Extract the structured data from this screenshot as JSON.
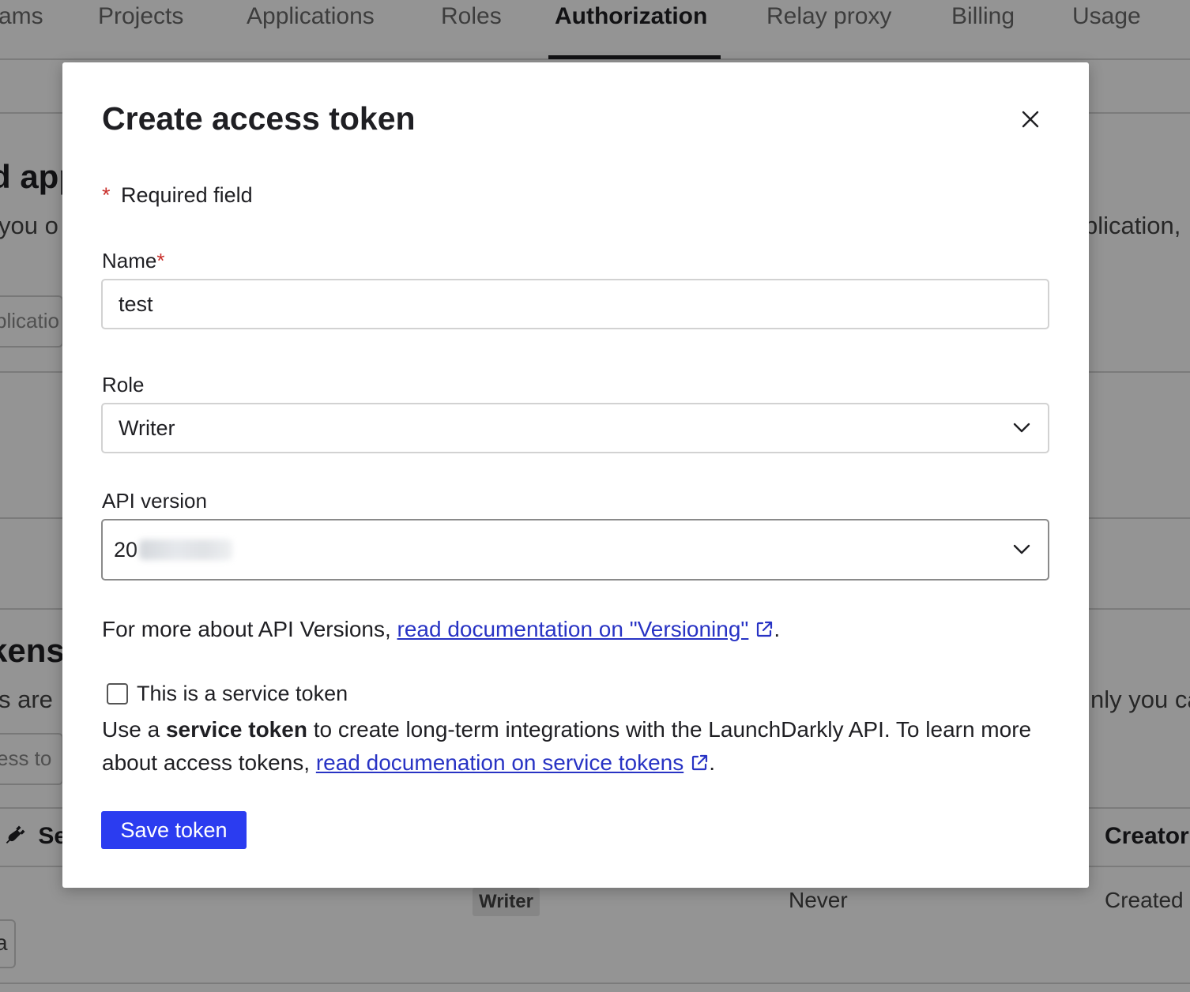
{
  "background": {
    "tabs": [
      "ams",
      "Projects",
      "Applications",
      "Roles",
      "Authorization",
      "Relay proxy",
      "Billing",
      "Usage"
    ],
    "active_tab": "Authorization",
    "heading_fragment": "d app",
    "body_fragment_left": "you o",
    "body_fragment_right": "plication,",
    "input_fragment": "plicatio",
    "tokens_heading_fragment": "kens",
    "tokens_body_left": "s are",
    "tokens_body_right": "nly you ca",
    "tokens_input_fragment": "ess to",
    "column_left_fragment": "Se",
    "column_creator": "Creator",
    "row_role_badge": "Writer",
    "row_expires": "Never",
    "row_created": "Created",
    "row_button_fragment": "a"
  },
  "modal": {
    "title": "Create access token",
    "required_note": "Required field",
    "required_star": "*",
    "name_label": "Name",
    "name_value": "test",
    "role_label": "Role",
    "role_value": "Writer",
    "api_version_label": "API version",
    "api_version_value": "20",
    "versioning_text_before": "For more about API Versions, ",
    "versioning_link": "read documentation on \"Versioning\"",
    "versioning_text_after": ".",
    "service_checkbox_label": "This is a service token",
    "service_desc_before": "Use a ",
    "service_desc_bold": "service token",
    "service_desc_middle": " to create long-term integrations with the LaunchDarkly API. To learn more about access tokens, ",
    "service_desc_link": "read documenation on service tokens",
    "service_desc_after": ".",
    "save_button": "Save token"
  },
  "colors": {
    "primary_button": "#2b3cf0",
    "link": "#2833c4",
    "required": "#c9302c"
  }
}
